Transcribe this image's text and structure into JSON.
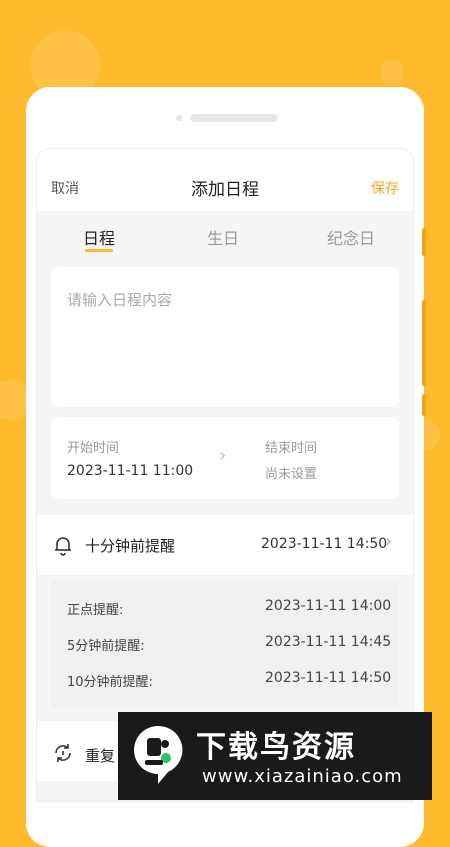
{
  "header": {
    "cancel": "取消",
    "title": "添加日程",
    "save": "保存"
  },
  "tabs": [
    {
      "label": "日程",
      "active": true
    },
    {
      "label": "生日",
      "active": false
    },
    {
      "label": "纪念日",
      "active": false
    }
  ],
  "content": {
    "placeholder": "请输入日程内容"
  },
  "time": {
    "start_label": "开始时间",
    "start_value": "2023-11-11 11:00",
    "end_label": "结束时间",
    "end_value": "尚未设置"
  },
  "reminder": {
    "label": "十分钟前提醒",
    "time": "2023-11-11   14:50"
  },
  "reminder_list": [
    {
      "label": "正点提醒:",
      "time": "2023-11-11   14:00"
    },
    {
      "label": "5分钟前提醒:",
      "time": "2023-11-11   14:45"
    },
    {
      "label": "10分钟前提醒:",
      "time": "2023-11-11   14:50"
    }
  ],
  "repeat": {
    "label": "重复"
  },
  "watermark": {
    "title": "下载鸟资源",
    "url": "www.xiazainiao.com"
  },
  "colors": {
    "accent": "#FDBA2C",
    "save": "#F5A623",
    "background": "#FDBA2C"
  }
}
